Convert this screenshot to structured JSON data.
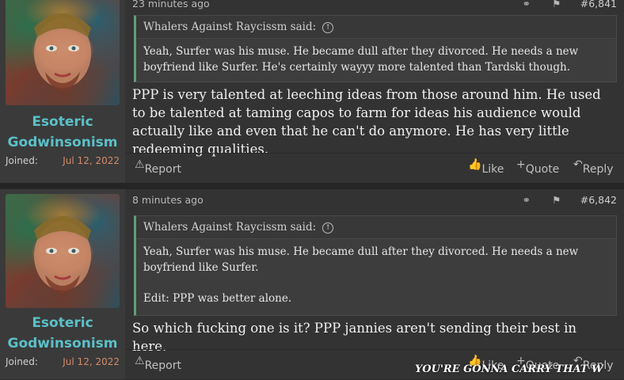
{
  "posts": [
    {
      "username": "Esoteric Godwinsonism",
      "joined_label": "Joined:",
      "joined_date": "Jul 12, 2022",
      "timestamp": "23 minutes ago",
      "post_number": "#6,841",
      "quote": {
        "author": "Whalers Against Raycissm said:",
        "text": "Yeah, Surfer was his muse. He became dull after they divorced. He needs a new boyfriend like Surfer. He's certainly wayyy more talented than Tardski though.",
        "edit": ""
      },
      "message": "PPP is very talented at leeching ideas from those around him. He used to be talented at taming capos to farm for ideas his audience would actually like and even that he can't do anymore. He has very little redeeming qualities.",
      "actions": {
        "report": "Report",
        "like": "Like",
        "quote": "Quote",
        "reply": "Reply"
      }
    },
    {
      "username": "Esoteric Godwinsonism",
      "joined_label": "Joined:",
      "joined_date": "Jul 12, 2022",
      "timestamp": "8 minutes ago",
      "post_number": "#6,842",
      "quote": {
        "author": "Whalers Against Raycissm said:",
        "text": "Yeah, Surfer was his muse. He became dull after they divorced. He needs a new boyfriend like Surfer.",
        "edit": "Edit: PPP was better alone."
      },
      "message": "So which fucking one is it? PPP jannies aren't sending their best in here.",
      "actions": {
        "report": "Report",
        "like": "Like",
        "quote": "Quote",
        "reply": "Reply"
      }
    }
  ],
  "overlay": "YOU'RE GONNA CARRY THAT W"
}
